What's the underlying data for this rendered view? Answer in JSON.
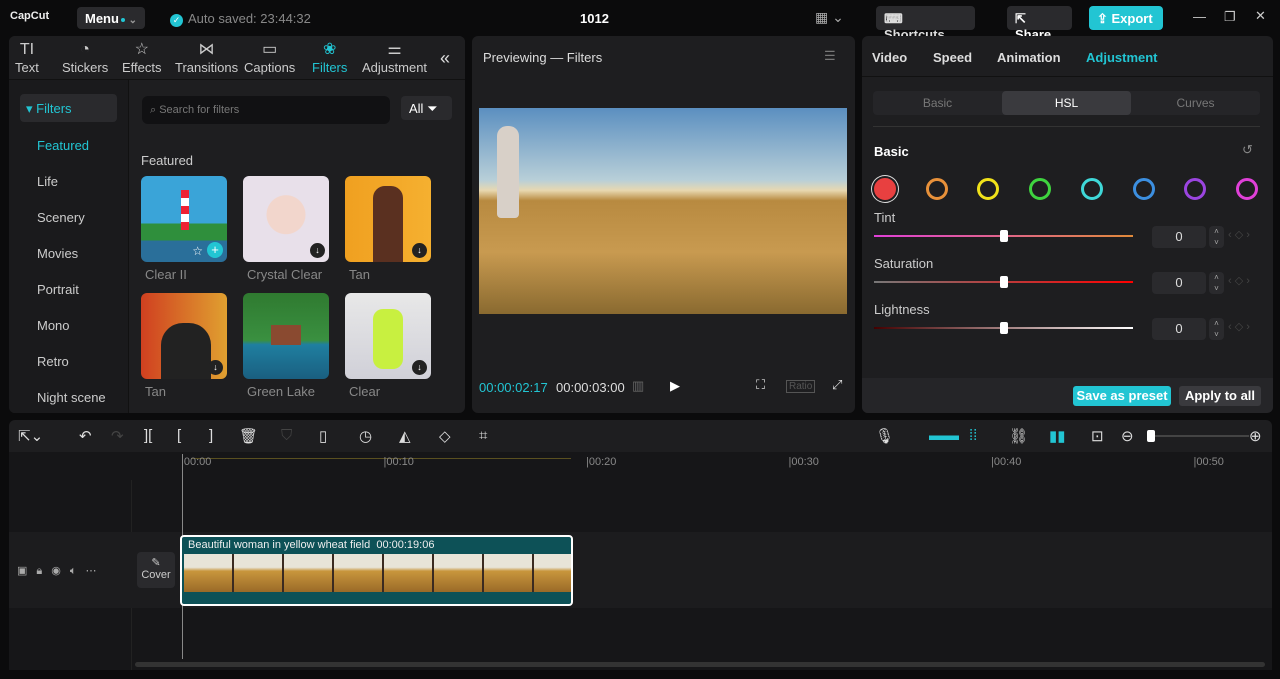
{
  "app": {
    "logo": "CapCut",
    "menu": "Menu",
    "autosave": "Auto saved: 23:44:32",
    "title": "1012",
    "shortcuts": "Shortcuts",
    "share": "Share",
    "export": "Export"
  },
  "tabs": [
    {
      "label": "Text",
      "icon": "TI"
    },
    {
      "label": "Stickers",
      "icon": "◔"
    },
    {
      "label": "Effects",
      "icon": "☆"
    },
    {
      "label": "Transitions",
      "icon": "⋈"
    },
    {
      "label": "Captions",
      "icon": "▭"
    },
    {
      "label": "Filters",
      "icon": "❀"
    },
    {
      "label": "Adjustment",
      "icon": "⚌"
    }
  ],
  "sidebar": {
    "header": "▾ Filters",
    "items": [
      "Featured",
      "Life",
      "Scenery",
      "Movies",
      "Portrait",
      "Mono",
      "Retro",
      "Night scene"
    ]
  },
  "search": {
    "placeholder": "Search for filters",
    "all": "All"
  },
  "section": "Featured",
  "filters": [
    "Clear II",
    "Crystal Clear",
    "Tan",
    "Tan",
    "Green Lake",
    "Clear"
  ],
  "preview": {
    "title": "Previewing — Filters",
    "current": "00:00:02:17",
    "total": "00:00:03:00",
    "ratio": "Ratio"
  },
  "right": {
    "tabs": [
      "Video",
      "Speed",
      "Animation",
      "Adjustment"
    ],
    "segments": [
      "Basic",
      "HSL",
      "Curves"
    ],
    "section": "Basic",
    "colors": [
      "#e84040",
      "#e8913a",
      "#f0e21a",
      "#3fd43f",
      "#3fd8d8",
      "#3c8fe0",
      "#9b45e0",
      "#e040d8"
    ],
    "sliders": [
      {
        "label": "Tint",
        "value": "0",
        "level": 0.5
      },
      {
        "label": "Saturation",
        "value": "0",
        "level": 0.5
      },
      {
        "label": "Lightness",
        "value": "0",
        "level": 0.5
      }
    ],
    "save": "Save as preset",
    "apply": "Apply to all"
  },
  "timeline": {
    "ruler": [
      "00:00",
      "00:10",
      "00:20",
      "00:30",
      "00:40",
      "00:50"
    ],
    "cover": "Cover",
    "clip_name": "Beautiful woman in yellow wheat field",
    "clip_duration": "00:00:19:06"
  }
}
